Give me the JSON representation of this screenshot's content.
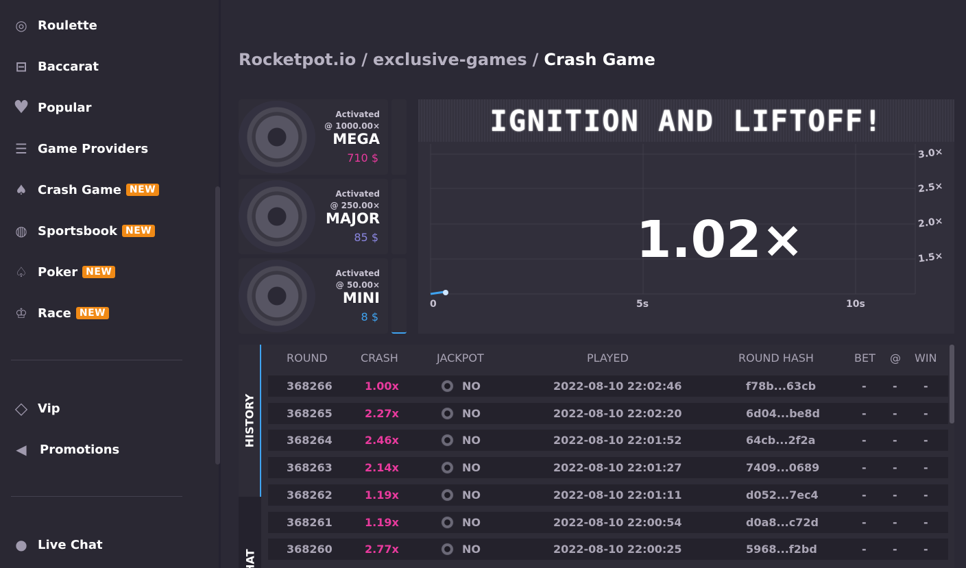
{
  "sidebar": {
    "items": [
      {
        "label": "Roulette",
        "icon": "roulette-icon",
        "glyph": "◎"
      },
      {
        "label": "Baccarat",
        "icon": "baccarat-icon",
        "glyph": "⊟"
      },
      {
        "label": "Popular",
        "icon": "heart-icon",
        "glyph": "♥"
      },
      {
        "label": "Game Providers",
        "icon": "sliders-icon",
        "glyph": "☰"
      },
      {
        "label": "Crash Game",
        "icon": "rocket-icon",
        "glyph": "♠",
        "badge": "NEW"
      },
      {
        "label": "Sportsbook",
        "icon": "ball-icon",
        "glyph": "◍",
        "badge": "NEW"
      },
      {
        "label": "Poker",
        "icon": "cards-icon",
        "glyph": "♤",
        "badge": "NEW"
      },
      {
        "label": "Race",
        "icon": "trophy-icon",
        "glyph": "♔",
        "badge": "NEW"
      }
    ],
    "vip": {
      "label": "Vip",
      "icon": "diamond-icon",
      "glyph": "◇"
    },
    "promotions": {
      "label": "Promotions",
      "icon": "megaphone-icon",
      "glyph": "◀"
    },
    "live_chat": {
      "label": "Live Chat",
      "icon": "chat-icon",
      "glyph": "●"
    }
  },
  "breadcrumb": {
    "root": "Rocketpot.io",
    "section": "exclusive-games",
    "current": "Crash Game",
    "separator": "/"
  },
  "jackpots": [
    {
      "activated": "Activated",
      "at": "@ 1000.00×",
      "level": "MEGA",
      "amount": "710 $",
      "color": "#e83a9d"
    },
    {
      "activated": "Activated",
      "at": "@ 250.00×",
      "level": "MAJOR",
      "amount": "85 $",
      "color": "#8a86e0"
    },
    {
      "activated": "Activated",
      "at": "@ 50.00×",
      "level": "MINI",
      "amount": "8 $",
      "color": "#3fa3f0"
    }
  ],
  "game": {
    "banner": "IGNITION AND LIFTOFF!",
    "multiplier": "1.02×",
    "x_ticks": [
      "0",
      "5s",
      "10s"
    ],
    "y_ticks": [
      "3.0×",
      "2.5×",
      "2.0×",
      "1.5×"
    ]
  },
  "tabs": {
    "history": "HISTORY",
    "chat": "CHAT"
  },
  "table": {
    "headers": [
      "ROUND",
      "CRASH",
      "JACKPOT",
      "PLAYED",
      "ROUND HASH",
      "BET",
      "@",
      "WIN"
    ],
    "rows": [
      {
        "round": "368266",
        "crash": "1.00x",
        "jackpot": "NO",
        "played": "2022-08-10 22:02:46",
        "hash": "f78b...63cb",
        "bet": "-",
        "at": "-",
        "win": "-"
      },
      {
        "round": "368265",
        "crash": "2.27x",
        "jackpot": "NO",
        "played": "2022-08-10 22:02:20",
        "hash": "6d04...be8d",
        "bet": "-",
        "at": "-",
        "win": "-"
      },
      {
        "round": "368264",
        "crash": "2.46x",
        "jackpot": "NO",
        "played": "2022-08-10 22:01:52",
        "hash": "64cb...2f2a",
        "bet": "-",
        "at": "-",
        "win": "-"
      },
      {
        "round": "368263",
        "crash": "2.14x",
        "jackpot": "NO",
        "played": "2022-08-10 22:01:27",
        "hash": "7409...0689",
        "bet": "-",
        "at": "-",
        "win": "-"
      },
      {
        "round": "368262",
        "crash": "1.19x",
        "jackpot": "NO",
        "played": "2022-08-10 22:01:11",
        "hash": "d052...7ec4",
        "bet": "-",
        "at": "-",
        "win": "-"
      },
      {
        "round": "368261",
        "crash": "1.19x",
        "jackpot": "NO",
        "played": "2022-08-10 22:00:54",
        "hash": "d0a8...c72d",
        "bet": "-",
        "at": "-",
        "win": "-"
      },
      {
        "round": "368260",
        "crash": "2.77x",
        "jackpot": "NO",
        "played": "2022-08-10 22:00:25",
        "hash": "5968...f2bd",
        "bet": "-",
        "at": "-",
        "win": "-"
      }
    ]
  },
  "colors": {
    "accent": "#f08a16",
    "crash": "#e83a9d",
    "tab_active": "#3fa3f0"
  }
}
